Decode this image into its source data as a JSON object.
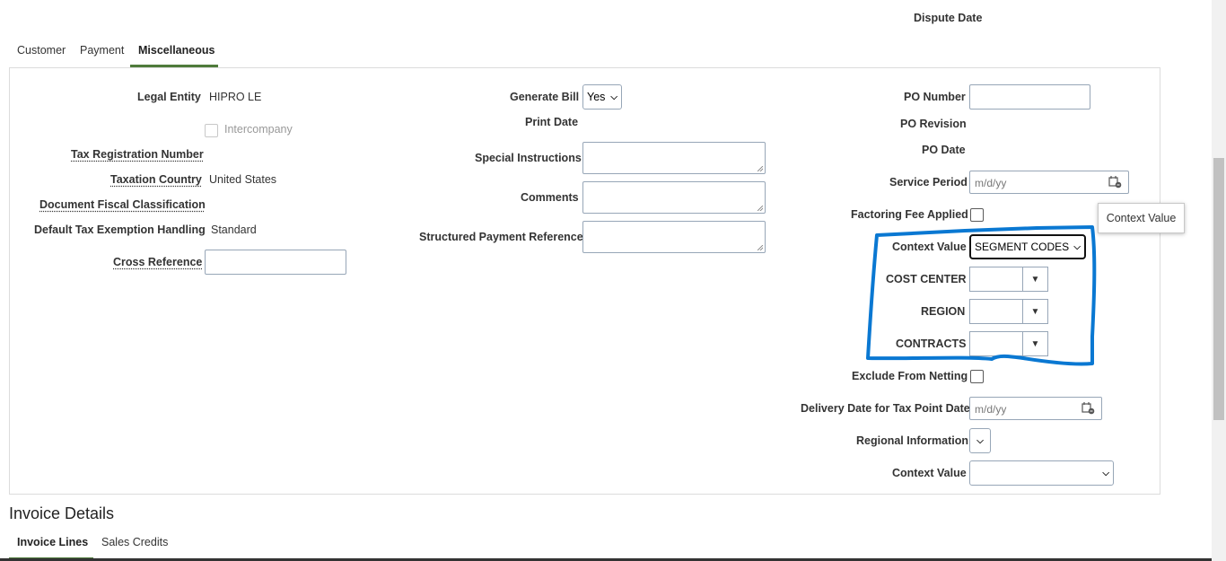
{
  "header": {
    "dispute_date_label": "Dispute Date"
  },
  "tabs": [
    {
      "label": "Customer"
    },
    {
      "label": "Payment"
    },
    {
      "label": "Miscellaneous"
    }
  ],
  "left": {
    "legal_entity_label": "Legal Entity",
    "legal_entity_value": "HIPRO LE",
    "intercompany_label": "Intercompany",
    "tax_registration_label": "Tax Registration Number",
    "taxation_country_label": "Taxation Country",
    "taxation_country_value": "United States",
    "document_fiscal_label": "Document Fiscal Classification",
    "default_tax_label": "Default Tax Exemption Handling",
    "default_tax_value": "Standard",
    "cross_reference_label": "Cross Reference"
  },
  "middle": {
    "generate_bill_label": "Generate Bill",
    "generate_bill_value": "Yes",
    "print_date_label": "Print Date",
    "special_instructions_label": "Special Instructions",
    "comments_label": "Comments",
    "structured_payment_label": "Structured Payment Reference"
  },
  "right": {
    "po_number_label": "PO Number",
    "po_revision_label": "PO Revision",
    "po_date_label": "PO Date",
    "service_period_label": "Service Period",
    "service_period_placeholder": "m/d/yy",
    "factoring_fee_label": "Factoring Fee Applied",
    "context_value_label": "Context Value",
    "context_value_value": "SEGMENT CODES",
    "cost_center_label": "COST CENTER",
    "region_label": "REGION",
    "contracts_label": "CONTRACTS",
    "exclude_netting_label": "Exclude From Netting",
    "delivery_date_label": "Delivery Date for Tax Point Date",
    "delivery_date_placeholder": "m/d/yy",
    "regional_info_label": "Regional Information",
    "context_value2_label": "Context Value"
  },
  "tooltip": {
    "text": "Context Value"
  },
  "invoice": {
    "title": "Invoice Details",
    "tabs": [
      {
        "label": "Invoice Lines"
      },
      {
        "label": "Sales Credits"
      }
    ]
  },
  "colors": {
    "annotation": "#0a78d2",
    "tab_active": "#4f7b3b"
  }
}
